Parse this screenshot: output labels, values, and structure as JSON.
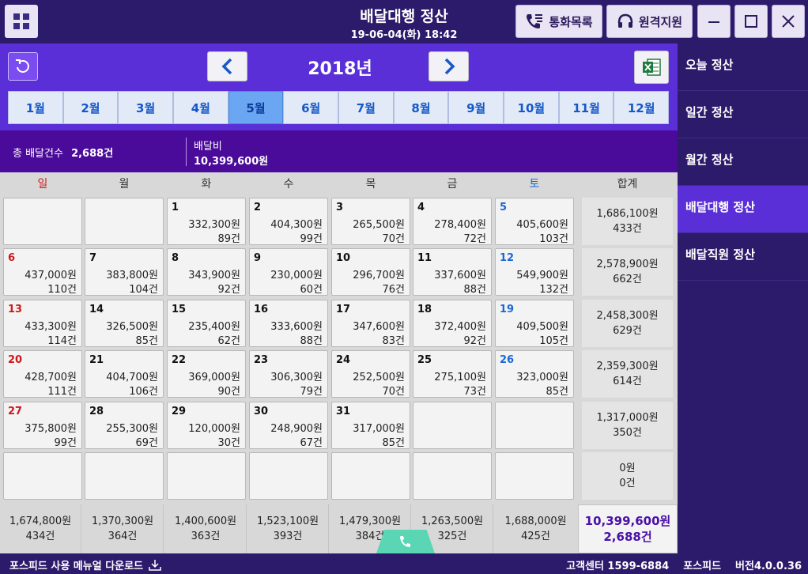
{
  "header": {
    "title": "배달대행 정산",
    "datetime": "19-06-04(화) 18:42",
    "call_log_label": "통화목록",
    "remote_support_label": "원격지원"
  },
  "sidebar": {
    "items": [
      {
        "label": "오늘 정산"
      },
      {
        "label": "일간 정산"
      },
      {
        "label": "월간 정산"
      },
      {
        "label": "배달대행 정산"
      },
      {
        "label": "배달직원 정산"
      }
    ],
    "active_index": 3
  },
  "yearbar": {
    "year": "2018년",
    "months": [
      "1월",
      "2월",
      "3월",
      "4월",
      "5월",
      "6월",
      "7월",
      "8월",
      "9월",
      "10월",
      "11월",
      "12월"
    ],
    "active_month_index": 4
  },
  "summary": {
    "total_label": "총 배달건수",
    "total_value": "2,688건",
    "fee_label": "배달비",
    "fee_value": "10,399,600원"
  },
  "calendar": {
    "weekdays": [
      "일",
      "월",
      "화",
      "수",
      "목",
      "금",
      "토"
    ],
    "total_header": "합계",
    "weeks": [
      [
        null,
        null,
        {
          "day": "1",
          "amount": "332,300원",
          "count": "89건"
        },
        {
          "day": "2",
          "amount": "404,300원",
          "count": "99건"
        },
        {
          "day": "3",
          "amount": "265,500원",
          "count": "70건"
        },
        {
          "day": "4",
          "amount": "278,400원",
          "count": "72건"
        },
        {
          "day": "5",
          "amount": "405,600원",
          "count": "103건"
        }
      ],
      [
        {
          "day": "6",
          "amount": "437,000원",
          "count": "110건"
        },
        {
          "day": "7",
          "amount": "383,800원",
          "count": "104건"
        },
        {
          "day": "8",
          "amount": "343,900원",
          "count": "92건"
        },
        {
          "day": "9",
          "amount": "230,000원",
          "count": "60건"
        },
        {
          "day": "10",
          "amount": "296,700원",
          "count": "76건"
        },
        {
          "day": "11",
          "amount": "337,600원",
          "count": "88건"
        },
        {
          "day": "12",
          "amount": "549,900원",
          "count": "132건"
        }
      ],
      [
        {
          "day": "13",
          "amount": "433,300원",
          "count": "114건"
        },
        {
          "day": "14",
          "amount": "326,500원",
          "count": "85건"
        },
        {
          "day": "15",
          "amount": "235,400원",
          "count": "62건"
        },
        {
          "day": "16",
          "amount": "333,600원",
          "count": "88건"
        },
        {
          "day": "17",
          "amount": "347,600원",
          "count": "83건"
        },
        {
          "day": "18",
          "amount": "372,400원",
          "count": "92건"
        },
        {
          "day": "19",
          "amount": "409,500원",
          "count": "105건"
        }
      ],
      [
        {
          "day": "20",
          "amount": "428,700원",
          "count": "111건"
        },
        {
          "day": "21",
          "amount": "404,700원",
          "count": "106건"
        },
        {
          "day": "22",
          "amount": "369,000원",
          "count": "90건"
        },
        {
          "day": "23",
          "amount": "306,300원",
          "count": "79건"
        },
        {
          "day": "24",
          "amount": "252,500원",
          "count": "70건"
        },
        {
          "day": "25",
          "amount": "275,100원",
          "count": "73건"
        },
        {
          "day": "26",
          "amount": "323,000원",
          "count": "85건"
        }
      ],
      [
        {
          "day": "27",
          "amount": "375,800원",
          "count": "99건"
        },
        {
          "day": "28",
          "amount": "255,300원",
          "count": "69건"
        },
        {
          "day": "29",
          "amount": "120,000원",
          "count": "30건"
        },
        {
          "day": "30",
          "amount": "248,900원",
          "count": "67건"
        },
        {
          "day": "31",
          "amount": "317,000원",
          "count": "85건"
        },
        null,
        null
      ],
      [
        null,
        null,
        null,
        null,
        null,
        null,
        null
      ]
    ],
    "week_totals": [
      {
        "amount": "1,686,100원",
        "count": "433건"
      },
      {
        "amount": "2,578,900원",
        "count": "662건"
      },
      {
        "amount": "2,458,300원",
        "count": "629건"
      },
      {
        "amount": "2,359,300원",
        "count": "614건"
      },
      {
        "amount": "1,317,000원",
        "count": "350건"
      },
      {
        "amount": "0원",
        "count": "0건"
      }
    ],
    "day_totals": [
      {
        "amount": "1,674,800원",
        "count": "434건"
      },
      {
        "amount": "1,370,300원",
        "count": "364건"
      },
      {
        "amount": "1,400,600원",
        "count": "363건"
      },
      {
        "amount": "1,523,100원",
        "count": "393건"
      },
      {
        "amount": "1,479,300원",
        "count": "384건"
      },
      {
        "amount": "1,263,500원",
        "count": "325건"
      },
      {
        "amount": "1,688,000원",
        "count": "425건"
      }
    ],
    "grand_total": {
      "amount": "10,399,600원",
      "count": "2,688건"
    }
  },
  "footer": {
    "manual_download": "포스피드 사용 메뉴얼 다운로드",
    "customer_center": "고객센터 1599-6884",
    "brand": "포스피드",
    "version": "버전4.0.0.36"
  }
}
